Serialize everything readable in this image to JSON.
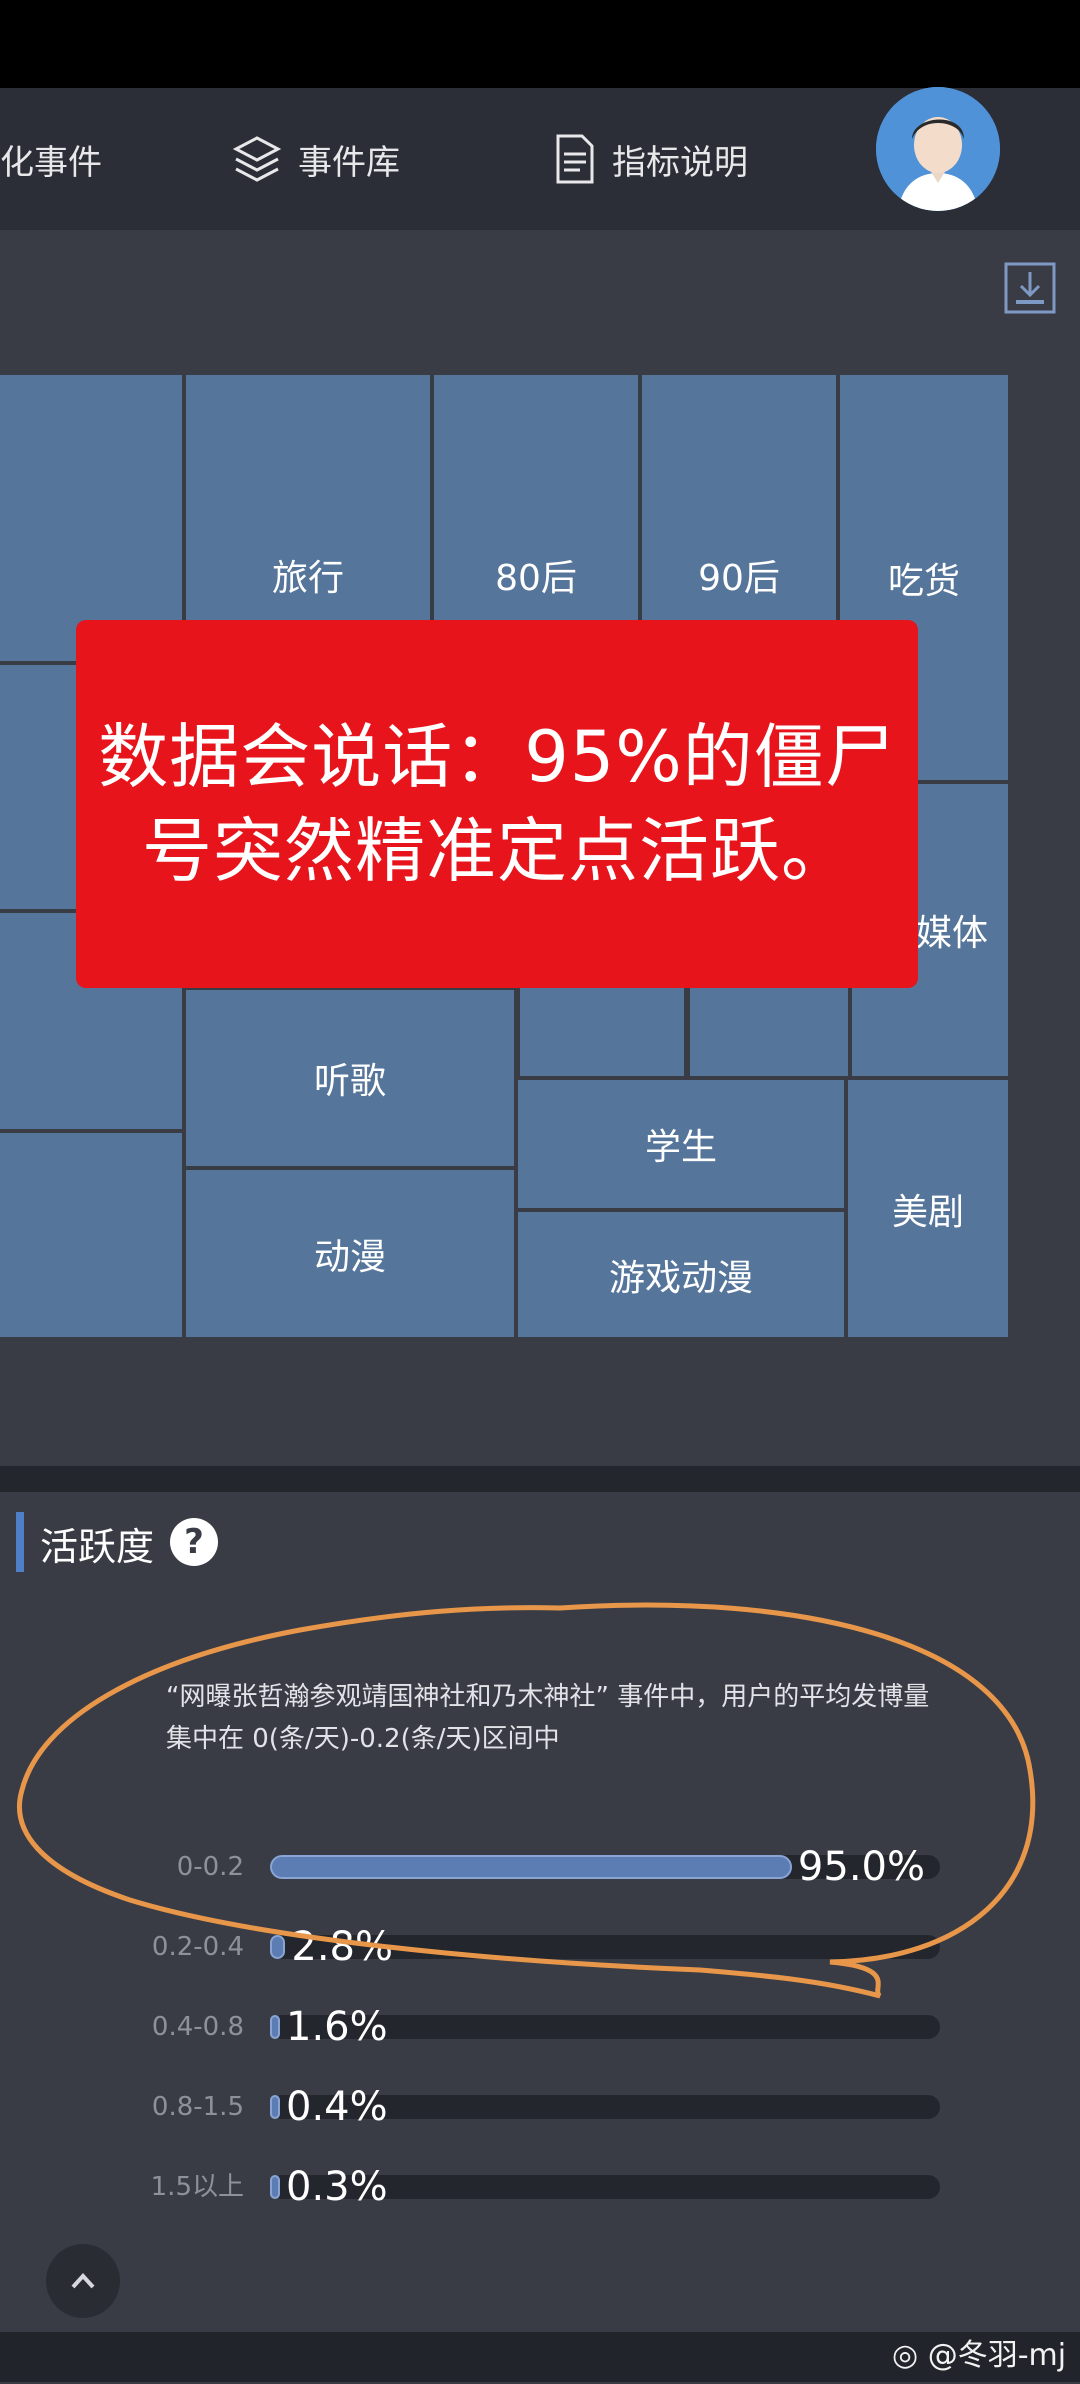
{
  "nav": {
    "item1_label": "化事件",
    "item2_label": "事件库",
    "item3_label": "指标说明"
  },
  "tiles": [
    {
      "label": "旅行"
    },
    {
      "label": "80后"
    },
    {
      "label": "90后"
    },
    {
      "label": "吃货"
    },
    {
      "label": "媒体"
    },
    {
      "label": "听歌"
    },
    {
      "label": "学生"
    },
    {
      "label": "美剧"
    },
    {
      "label": "动漫"
    },
    {
      "label": "游戏动漫"
    }
  ],
  "banner": {
    "text": "数据会说话：95%的僵尸号突然精准定点活跃。"
  },
  "activity": {
    "title": "活跃度",
    "help_symbol": "?",
    "description": "“网曝张哲瀚参观靖国神社和乃木神社” 事件中，用户的平均发博量集中在 0(条/天)-0.2(条/天)区间中",
    "rows": [
      {
        "range": "0-0.2",
        "percent_label": "95.0%",
        "percent": 95.0
      },
      {
        "range": "0.2-0.4",
        "percent_label": "2.8%",
        "percent": 2.8
      },
      {
        "range": "0.4-0.8",
        "percent_label": "1.6%",
        "percent": 1.6
      },
      {
        "range": "0.8-1.5",
        "percent_label": "0.4%",
        "percent": 0.4
      },
      {
        "range": "1.5以上",
        "percent_label": "0.3%",
        "percent": 0.3
      }
    ]
  },
  "watermark": "@冬羽-mj",
  "colors": {
    "tile": "#56759b",
    "banner": "#e8141c",
    "annotation": "#e8974a",
    "bar_fill": "#5b7db4"
  }
}
